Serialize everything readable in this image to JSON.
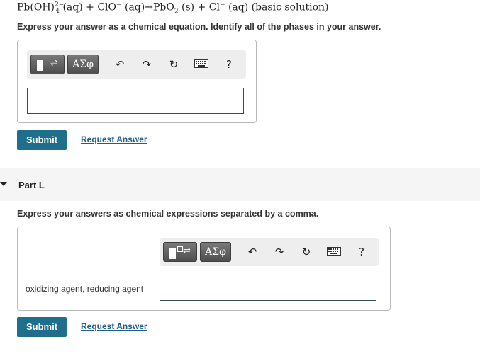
{
  "question": {
    "equation_prefix": "Pb(OH)",
    "equation_sup": "2−",
    "equation_sub": "4",
    "equation_rest": " (aq) + ClO",
    "clo_sup": "−",
    "equation_rest2": " (aq)→PbO",
    "pbo_sub": "2",
    "equation_rest3": " (s) + Cl",
    "cl_sup": "−",
    "equation_rest4": " (aq) (basic solution)",
    "instruction": "Express your answer as a chemical equation. Identify all of the phases in your answer."
  },
  "toolbar": {
    "greek_label": "ΑΣφ",
    "help_label": "?",
    "icons": [
      "templates-icon",
      "greek-symbols-icon",
      "undo-icon",
      "redo-icon",
      "reset-icon",
      "keyboard-icon",
      "help-icon"
    ]
  },
  "part_k": {
    "answer_value": "",
    "submit_label": "Submit",
    "request_label": "Request Answer"
  },
  "part_l": {
    "title": "Part L",
    "instruction": "Express your answers as chemical expressions separated by a comma.",
    "field_label": "oxidizing agent, reducing agent",
    "answer_value": "",
    "submit_label": "Submit",
    "request_label": "Request Answer"
  },
  "colors": {
    "submit_bg": "#1f6e8c",
    "link": "#1f5f8c",
    "toolbar_bg": "#eeeeee"
  }
}
